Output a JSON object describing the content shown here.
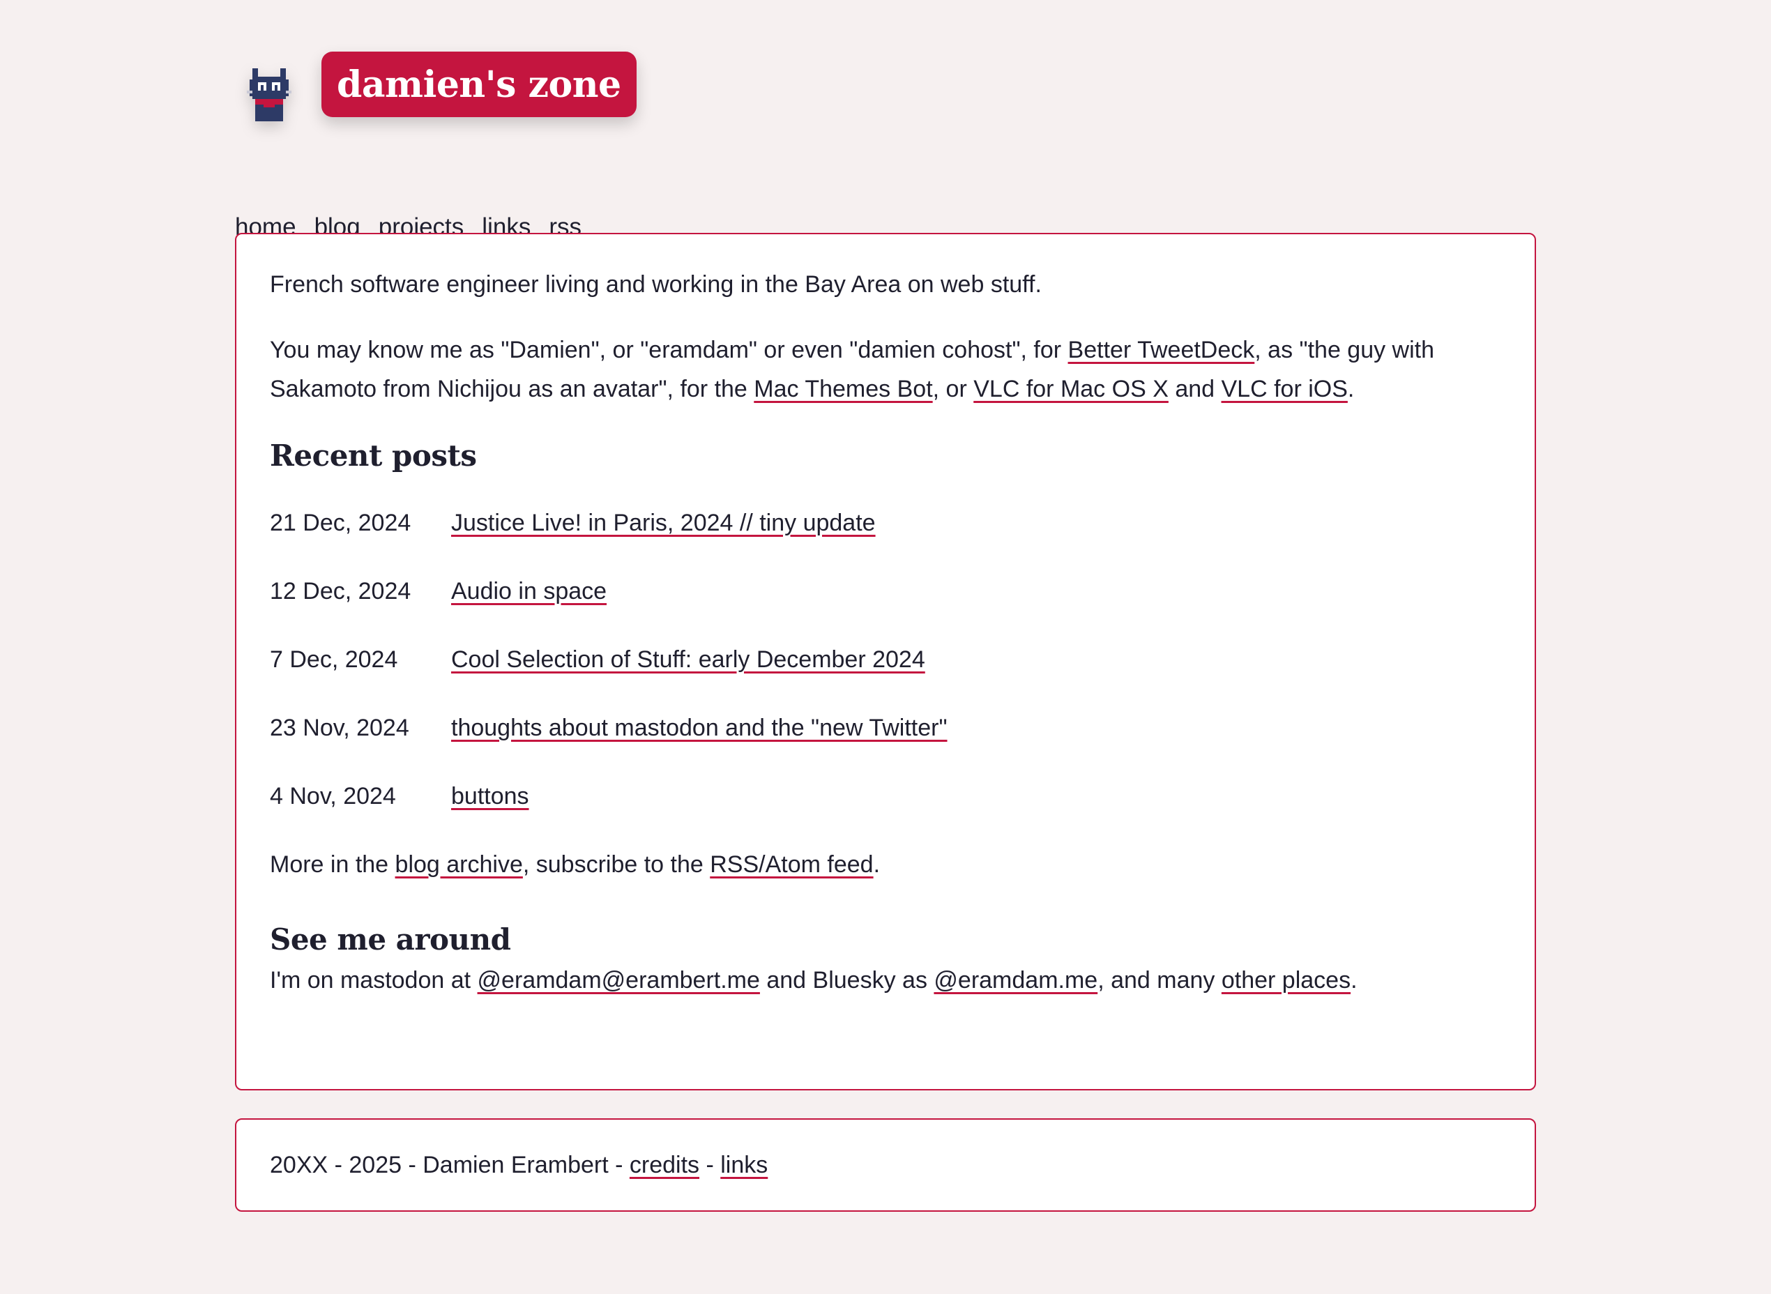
{
  "site": {
    "title": "damien's zone",
    "avatar_icon": "pixel-cat-avatar-icon",
    "accent_color": "#c4153f",
    "background_color": "#f6f0f0"
  },
  "nav": {
    "items": [
      {
        "label": "home"
      },
      {
        "label": "blog"
      },
      {
        "label": "projects"
      },
      {
        "label": "links"
      },
      {
        "label": "rss"
      }
    ]
  },
  "intro": {
    "line1": "French software engineer living and working in the Bay Area on web stuff.",
    "p2_a": "You may know me as \"Damien\", or \"eramdam\" or even \"damien cohost\", for ",
    "p2_link1": "Better TweetDeck",
    "p2_b": ", as \"the guy with Sakamoto from Nichijou as an avatar\", for the ",
    "p2_link2": "Mac Themes Bot",
    "p2_c": ", or ",
    "p2_link3": "VLC for Mac OS X",
    "p2_d": " and ",
    "p2_link4": "VLC for iOS",
    "p2_e": "."
  },
  "recent_posts": {
    "heading": "Recent posts",
    "posts": [
      {
        "date": "21 Dec, 2024",
        "title": "Justice Live! in Paris, 2024 // tiny update"
      },
      {
        "date": "12 Dec, 2024",
        "title": "Audio in space"
      },
      {
        "date": "7 Dec, 2024",
        "title": "Cool Selection of Stuff: early December 2024"
      },
      {
        "date": "23 Nov, 2024",
        "title": "thoughts about mastodon and the \"new Twitter\""
      },
      {
        "date": "4 Nov, 2024",
        "title": "buttons"
      }
    ],
    "more_a": "More in the ",
    "more_link1": "blog archive",
    "more_b": ", subscribe to the ",
    "more_link2": "RSS/Atom feed",
    "more_c": "."
  },
  "see_me_around": {
    "heading": "See me around",
    "a": "I'm on mastodon at ",
    "link1": "@eramdam@erambert.me",
    "b": " and Bluesky as ",
    "link2": "@eramdam.me",
    "c": ", and many ",
    "link3": "other places",
    "d": "."
  },
  "footer": {
    "a": "20XX - 2025 - Damien Erambert - ",
    "link1": "credits",
    "b": " - ",
    "link2": "links"
  }
}
